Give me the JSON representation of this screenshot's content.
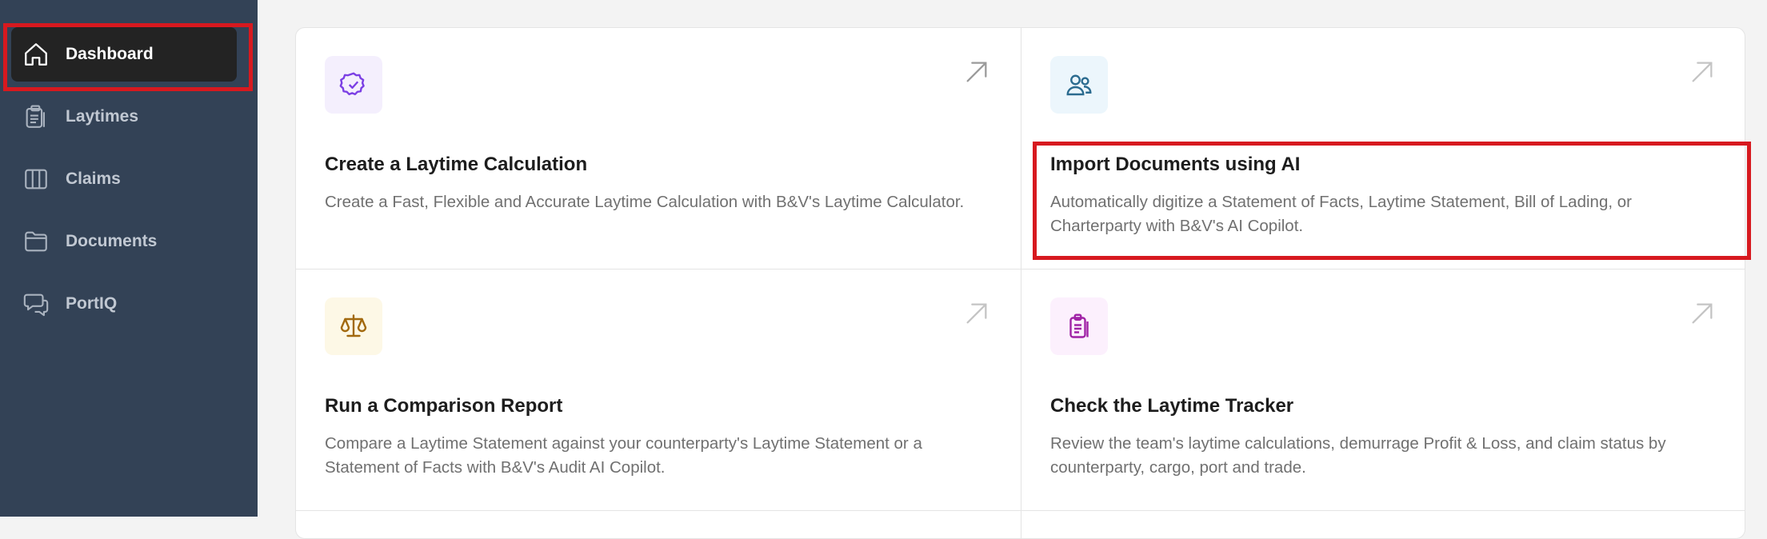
{
  "sidebar": {
    "items": [
      {
        "label": "Dashboard",
        "icon": "home-icon",
        "active": true
      },
      {
        "label": "Laytimes",
        "icon": "clipboard-icon",
        "active": false
      },
      {
        "label": "Claims",
        "icon": "columns-icon",
        "active": false
      },
      {
        "label": "Documents",
        "icon": "folder-icon",
        "active": false
      },
      {
        "label": "PortIQ",
        "icon": "chat-icon",
        "active": false
      }
    ]
  },
  "cards": [
    {
      "title": "Create a Laytime Calculation",
      "description": "Create a Fast, Flexible and Accurate Laytime Calculation with B&V's Laytime Calculator.",
      "icon": "badge-check-icon",
      "icon_color": "#7b3fe4",
      "icon_bg": "#f4effd"
    },
    {
      "title": "Import Documents using AI",
      "description": "Automatically digitize a Statement of Facts, Laytime Statement, Bill of Lading, or Charterparty with B&V's AI Copilot.",
      "icon": "users-icon",
      "icon_color": "#2b6b8f",
      "icon_bg": "#ecf6fc"
    },
    {
      "title": "Run a Comparison Report",
      "description": "Compare a Laytime Statement against your counterparty's Laytime Statement or a Statement of Facts with B&V's Audit AI Copilot.",
      "icon": "scale-icon",
      "icon_color": "#a2690e",
      "icon_bg": "#fdf8e6"
    },
    {
      "title": "Check the Laytime Tracker",
      "description": "Review the team's laytime calculations, demurrage Profit & Loss, and claim status by counterparty, cargo, port and trade.",
      "icon": "clipboard-list-icon",
      "icon_color": "#a023a6",
      "icon_bg": "#fcf0fd"
    }
  ],
  "colors": {
    "sidebar_bg": "#334256",
    "active_bg": "#232323",
    "highlight": "#d7191f"
  }
}
